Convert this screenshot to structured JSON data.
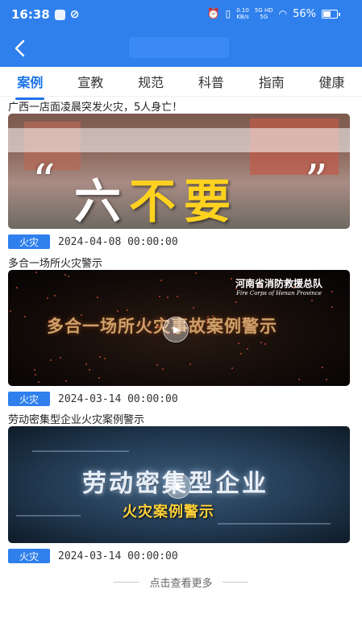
{
  "status_bar": {
    "time": "16:38",
    "net_speed_top": "0.10",
    "net_speed_bottom": "KB/s",
    "signal_top": "5G HD",
    "signal_bottom": "5G",
    "battery": "56%",
    "battery_level": 0.56
  },
  "nav": {
    "back_icon": "chevron-left-icon"
  },
  "tabs": [
    {
      "label": "案例",
      "active": true
    },
    {
      "label": "宣教",
      "active": false
    },
    {
      "label": "规范",
      "active": false
    },
    {
      "label": "科普",
      "active": false
    },
    {
      "label": "指南",
      "active": false
    },
    {
      "label": "健康",
      "active": false
    }
  ],
  "items": [
    {
      "title": "广西一店面凌晨突发火灾，5人身亡！",
      "thumb_text": {
        "q_open": "“",
        "w1": "六",
        "w2": "不要",
        "q_close": "”"
      },
      "tag": "火灾",
      "date": "2024-04-08 00:00:00"
    },
    {
      "title": "多合一场所火灾警示",
      "thumb_text": {
        "org_cn": "河南省消防救援总队",
        "org_en": "Fire Corps of Henan Province",
        "headline": "多合一场所火灾事故案例警示"
      },
      "tag": "火灾",
      "date": "2024-03-14 00:00:00"
    },
    {
      "title": "劳动密集型企业火灾案例警示",
      "thumb_text": {
        "headline1": "劳动密集型企业",
        "headline2": "火灾案例警示"
      },
      "tag": "火灾",
      "date": "2024-03-14 00:00:00"
    }
  ],
  "load_more": "点击查看更多",
  "colors": {
    "primary": "#2f80ed",
    "tab_active": "#1a73e8",
    "highlight_yellow": "#ffd21f"
  }
}
